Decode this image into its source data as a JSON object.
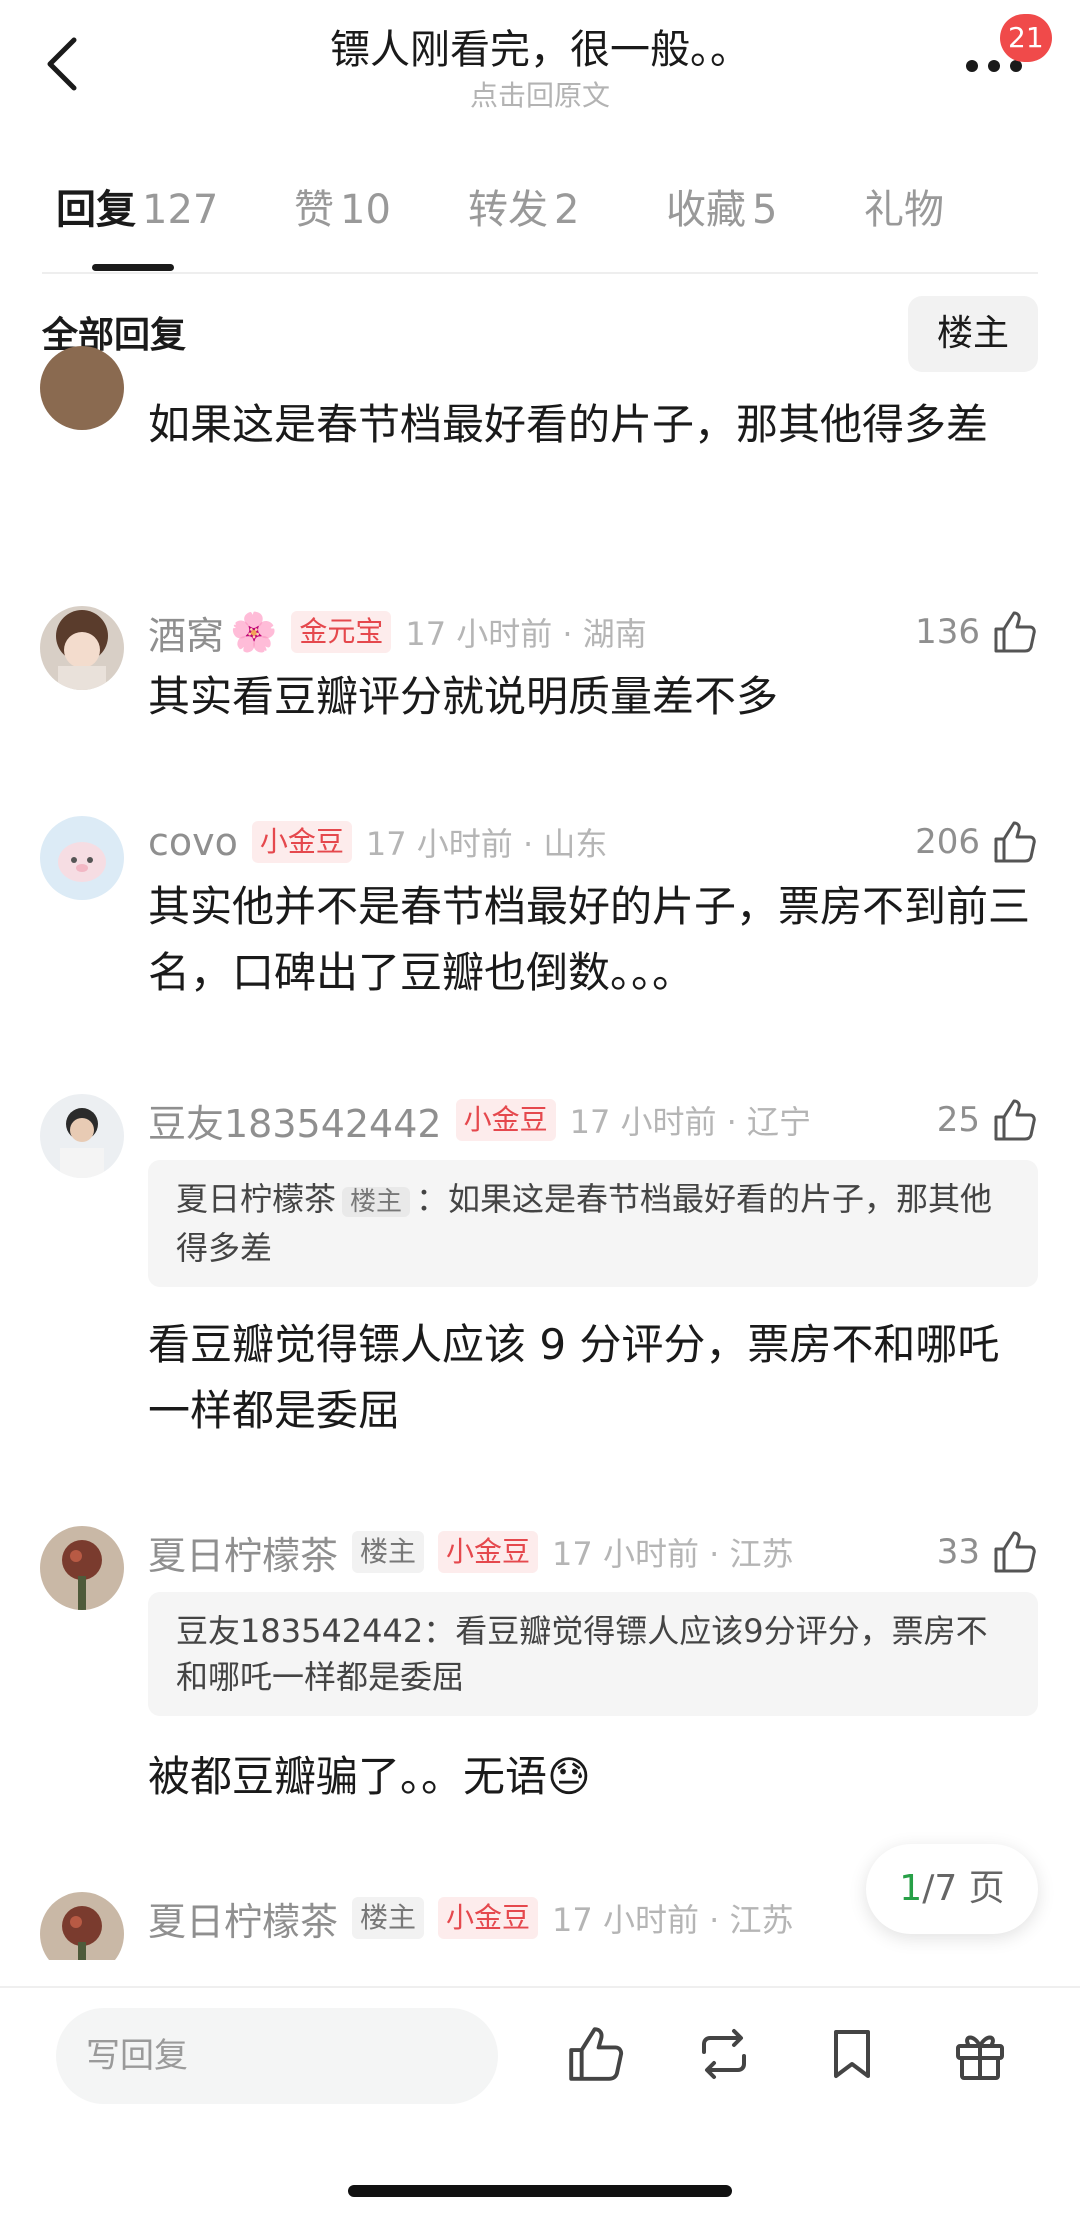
{
  "header": {
    "title": "镖人刚看完，很一般。。",
    "subtitle": "点击回原文",
    "notification_count": "21"
  },
  "tabs": [
    {
      "label": "回复",
      "count": "127"
    },
    {
      "label": "赞",
      "count": "10"
    },
    {
      "label": "转发",
      "count": "2"
    },
    {
      "label": "收藏",
      "count": "5"
    },
    {
      "label": "礼物",
      "count": ""
    }
  ],
  "filter": {
    "label": "全部回复",
    "op_toggle": "楼主"
  },
  "comments": [
    {
      "text": "如果这是春节档最好看的片子，那其他得多差"
    },
    {
      "name": "酒窝",
      "flower": "🌸",
      "coin_tag": "金元宝",
      "time": "17 小时前 · 湖南",
      "likes": "136",
      "text": "其实看豆瓣评分就说明质量差不多"
    },
    {
      "name": "covo",
      "coin_tag": "小金豆",
      "time": "17 小时前 · 山东",
      "likes": "206",
      "text": "其实他并不是春节档最好的片子，票房不到前三名，口碑出了豆瓣也倒数。。。"
    },
    {
      "name": "豆友183542442",
      "coin_tag": "小金豆",
      "time": "17 小时前 · 辽宁",
      "likes": "25",
      "quote_author": "夏日柠檬茶",
      "quote_tag": "楼主",
      "quote_text": "：如果这是春节档最好看的片子，那其他得多差",
      "text": "看豆瓣觉得镖人应该 9 分评分，票房不和哪吒一样都是委屈"
    },
    {
      "name": "夏日柠檬茶",
      "op_tag": "楼主",
      "coin_tag": "小金豆",
      "time": "17 小时前 · 江苏",
      "likes": "33",
      "quote_author": "豆友183542442",
      "quote_text": "：看豆瓣觉得镖人应该9分评分，票房不和哪吒一样都是委屈",
      "text": "被都豆瓣骗了。。无语",
      "emoji": "😓"
    },
    {
      "name": "夏日柠檬茶",
      "op_tag": "楼主",
      "coin_tag": "小金豆",
      "time": "17 小时前 · 江苏"
    }
  ],
  "pager": {
    "current": "1",
    "total_text": "/7 页"
  },
  "bottom_bar": {
    "reply_placeholder": "写回复"
  }
}
